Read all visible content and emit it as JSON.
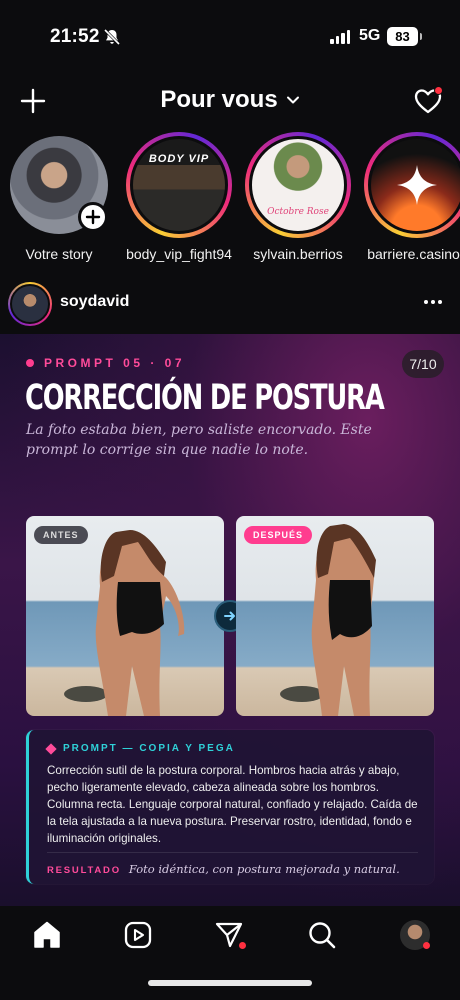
{
  "status_bar": {
    "time": "21:52",
    "network": "5G",
    "battery": "83"
  },
  "header": {
    "title": "Pour vous"
  },
  "stories": [
    {
      "label": "Votre story"
    },
    {
      "label": "body_vip_fight94",
      "thumb_text": "BODY VIP"
    },
    {
      "label": "sylvain.berrios",
      "thumb_text": "Octobre Rose"
    },
    {
      "label": "barriere.casinos"
    }
  ],
  "post": {
    "username": "soydavid",
    "kicker": "PROMPT 05 · 07",
    "pager": "7/10",
    "headline": "CORRECCIÓN DE POSTURA",
    "subtitle": "La foto estaba bien, pero saliste encorvado. Este prompt lo corrige sin que nadie lo note.",
    "before_tag": "ANTES",
    "after_tag": "DESPUÉS",
    "prompt_header": "PROMPT — COPIA Y PEGA",
    "prompt_body": "Corrección sutil de la postura corporal. Hombros hacia atrás y abajo, pecho ligeramente elevado, cabeza alineada sobre los hombros. Columna recta. Lenguaje corporal natural, confiado y relajado. Caída de la tela ajustada a la nueva postura. Preservar rostro, identidad, fondo e iluminación originales.",
    "result_label": "RESULTADO",
    "result_text": "Foto idéntica, con postura mejorada y natural."
  },
  "colors": {
    "accent_pink": "#ff4b9a",
    "accent_cyan": "#2fd1d8",
    "notification": "#ff3040"
  }
}
